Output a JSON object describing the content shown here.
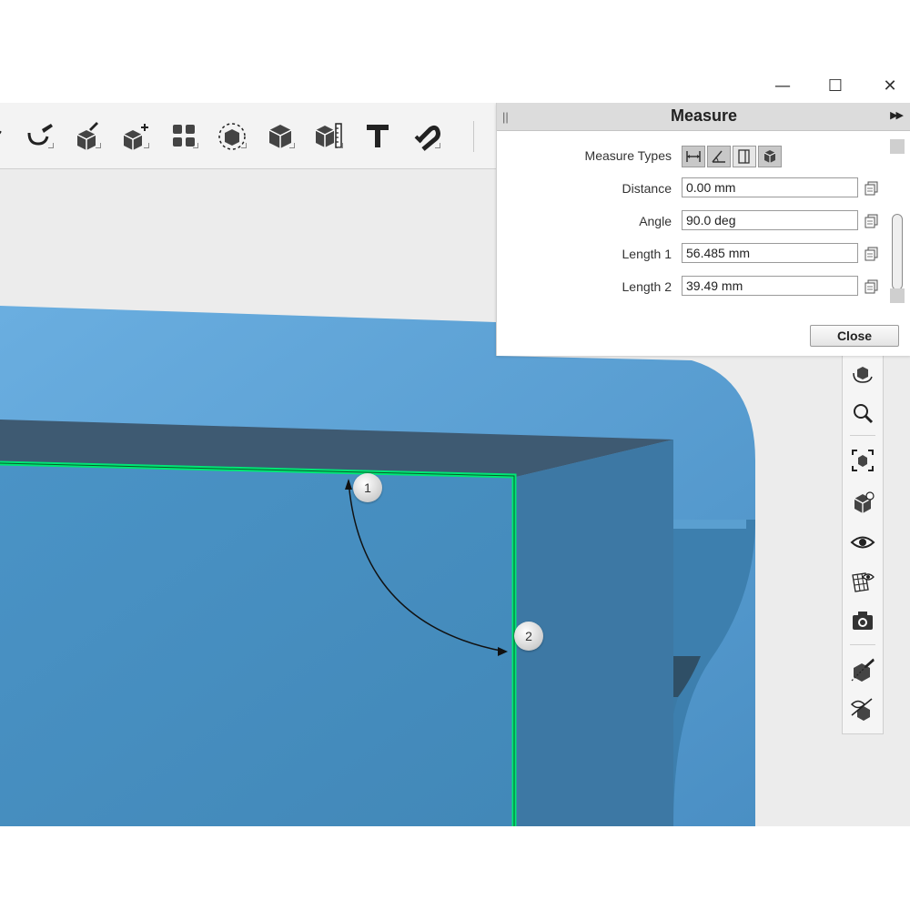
{
  "window_controls": {
    "minimize": "—",
    "maximize": "☐",
    "close": "✕"
  },
  "toolbar": {
    "icons": [
      "curve-icon",
      "sketch-edit-icon",
      "paint-brush-icon",
      "move-body-icon",
      "pattern-icon",
      "rotate-select-icon",
      "solid-cube-icon",
      "measure-ruler-icon",
      "text-icon",
      "magnet-icon"
    ]
  },
  "measure_panel": {
    "title": "Measure",
    "measure_types_label": "Measure Types",
    "distance_label": "Distance",
    "distance_value": "0.00 mm",
    "angle_label": "Angle",
    "angle_value": "90.0 deg",
    "length1_label": "Length 1",
    "length1_value": "56.485 mm",
    "length2_label": "Length 2",
    "length2_value": "39.49 mm",
    "close_label": "Close"
  },
  "markers": {
    "first": "1",
    "second": "2"
  },
  "colors": {
    "model": "#4a8fc0",
    "edge_highlight": "#00e676",
    "panel_header": "#dcdcdc",
    "viewport_bg": "#ececec"
  },
  "right_toolbar": {
    "icons": [
      "orbit-icon",
      "zoom-icon",
      "fit-view-icon",
      "view-cube-icon",
      "visibility-icon",
      "mesh-view-icon",
      "camera-icon",
      "hide-part-icon",
      "show-part-icon"
    ]
  }
}
